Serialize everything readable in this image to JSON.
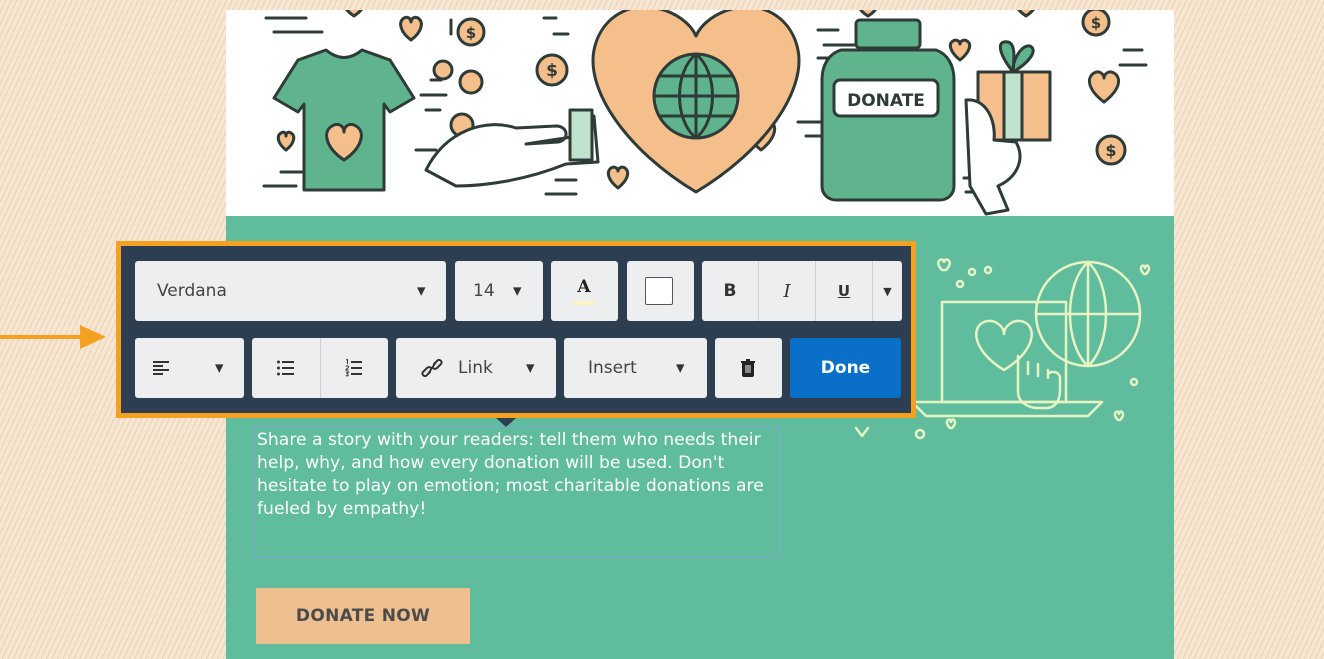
{
  "toolbar": {
    "font_family": "Verdana",
    "font_size": "14",
    "text_color_glyph": "A",
    "bold": "B",
    "italic": "I",
    "underline": "U",
    "link_label": "Link",
    "insert_label": "Insert",
    "done_label": "Done"
  },
  "hero": {
    "jar_label": "DONATE",
    "coin_symbol": "$"
  },
  "content": {
    "body_text": "Share a story with your readers: tell them who needs their help, why, and how every donation will be used. Don't hesitate to play on emotion; most charitable donations are fueled by empathy!",
    "donate_button": "DONATE NOW"
  },
  "colors": {
    "accent": "#f5a020",
    "toolbar_bg": "#2c3e50",
    "done_blue": "#0a6fc8",
    "email_green": "#5fbc9c",
    "button_peach": "#efc08f",
    "heart_peach": "#f5bf8c",
    "illus_green": "#5fb48e"
  },
  "icons": [
    "chevron-down-icon",
    "text-color-icon",
    "background-color-icon",
    "align-left-icon",
    "bullet-list-icon",
    "numbered-list-icon",
    "link-icon",
    "trash-icon",
    "arrow-icon",
    "heart-icon",
    "globe-icon",
    "coin-icon",
    "tshirt-icon",
    "jar-icon",
    "gift-icon",
    "hand-icon",
    "laptop-icon",
    "pointer-hand-icon"
  ]
}
